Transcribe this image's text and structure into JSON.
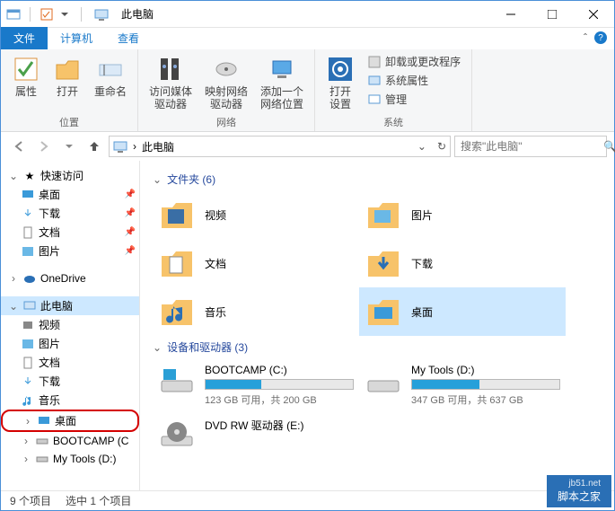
{
  "window": {
    "title": "此电脑"
  },
  "tabs": {
    "file": "文件",
    "computer": "计算机",
    "view": "查看"
  },
  "ribbon": {
    "g1": {
      "name": "位置",
      "properties": "属性",
      "open": "打开",
      "rename": "重命名"
    },
    "g2": {
      "name": "网络",
      "media": "访问媒体",
      "mediaSub": "驱动器",
      "map": "映射网络",
      "mapSub": "驱动器",
      "addnet": "添加一个",
      "addnetSub": "网络位置"
    },
    "g3": {
      "name": "系统",
      "settings": "打开",
      "settingsSub": "设置",
      "uninstall": "卸载或更改程序",
      "sysprop": "系统属性",
      "manage": "管理"
    }
  },
  "address": {
    "crumb": "此电脑"
  },
  "search": {
    "placeholder": "搜索\"此电脑\""
  },
  "tree": {
    "quick": "快速访问",
    "desktop": "桌面",
    "downloads": "下载",
    "documents": "文档",
    "pictures": "图片",
    "onedrive": "OneDrive",
    "thispc": "此电脑",
    "videos": "视频",
    "pictures2": "图片",
    "documents2": "文档",
    "downloads2": "下载",
    "music": "音乐",
    "desktop2": "桌面",
    "bootcamp": "BOOTCAMP (C",
    "mytools": "My Tools (D:)"
  },
  "sections": {
    "folders": "文件夹 (6)",
    "drives": "设备和驱动器 (3)"
  },
  "folders": {
    "videos": "视频",
    "pictures": "图片",
    "documents": "文档",
    "downloads": "下载",
    "music": "音乐",
    "desktop": "桌面"
  },
  "drives": {
    "c": {
      "name": "BOOTCAMP (C:)",
      "stat": "123 GB 可用，共 200 GB",
      "fillPct": 38
    },
    "d": {
      "name": "My Tools (D:)",
      "stat": "347 GB 可用，共 637 GB",
      "fillPct": 46
    },
    "e": {
      "name": "DVD RW 驱动器 (E:)"
    }
  },
  "status": {
    "count": "9 个项目",
    "selected": "选中 1 个项目"
  },
  "watermark": {
    "site": "jb51.net",
    "text": "脚本之家"
  }
}
